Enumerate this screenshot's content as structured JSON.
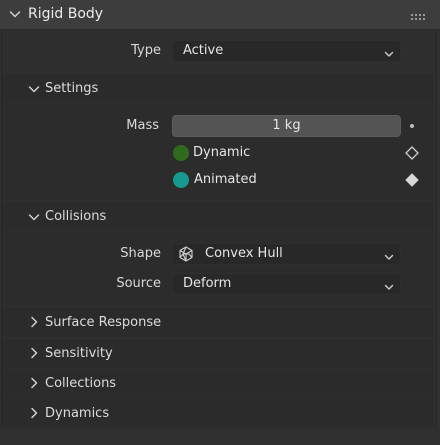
{
  "panel": {
    "title": "Rigid Body"
  },
  "type_row": {
    "label": "Type",
    "value": "Active"
  },
  "settings": {
    "title": "Settings",
    "mass": {
      "label": "Mass",
      "value": "1 kg"
    },
    "dynamic": {
      "label": "Dynamic",
      "color": "#2f6a1f"
    },
    "animated": {
      "label": "Animated",
      "color": "#169a90"
    }
  },
  "collisions": {
    "title": "Collisions",
    "shape": {
      "label": "Shape",
      "value": "Convex Hull",
      "icon": "convex-hull-icon"
    },
    "source": {
      "label": "Source",
      "value": "Deform"
    }
  },
  "collapsed_sections": [
    {
      "title": "Surface Response"
    },
    {
      "title": "Sensitivity"
    },
    {
      "title": "Collections"
    },
    {
      "title": "Dynamics"
    }
  ]
}
